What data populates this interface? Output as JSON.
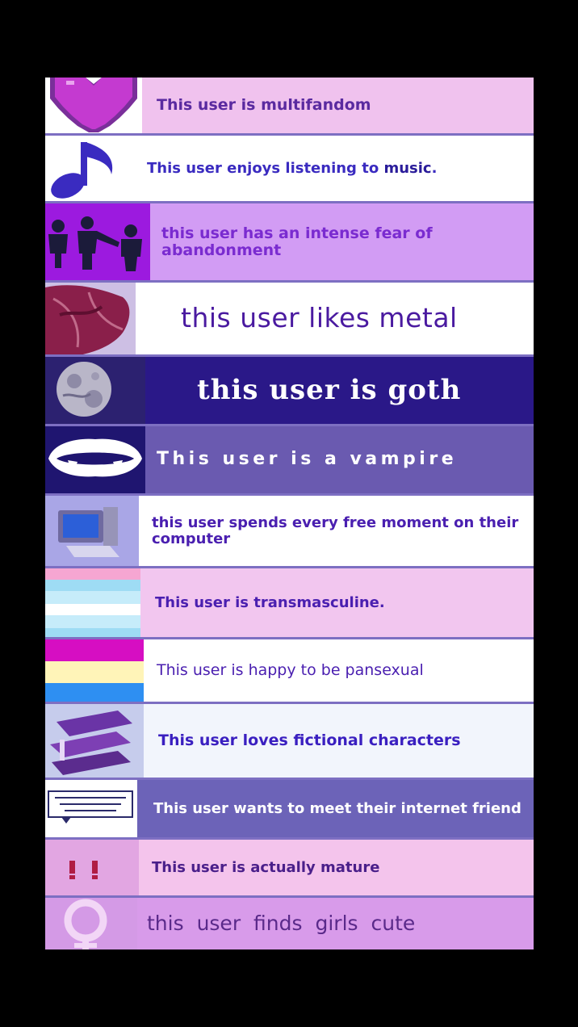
{
  "userboxes": [
    {
      "text": "This user is multifandom",
      "icon": "pixel-heart-icon"
    },
    {
      "text_before": "This user enjoys listening to ",
      "text_emphasis": "music",
      "text_after": ".",
      "icon": "music-note-icon"
    },
    {
      "text": "this user has an intense fear of abandonment",
      "icon": "people-pointing-icon"
    },
    {
      "text": "this user likes metal",
      "icon": "red-crumpled-texture-icon"
    },
    {
      "text": "this user is goth",
      "icon": "moon-icon"
    },
    {
      "text": "This user is a vampire",
      "icon": "fangs-icon"
    },
    {
      "text": "this user spends every free moment on their computer",
      "icon": "computer-icon"
    },
    {
      "text": "This user is transmasculine.",
      "icon": "transmasculine-flag-icon"
    },
    {
      "text": "This user is happy to be pansexual",
      "icon": "pansexual-flag-icon"
    },
    {
      "text": "This user loves fictional characters",
      "icon": "books-icon"
    },
    {
      "text": "This user wants to meet their internet friend",
      "icon": "note-card-icon"
    },
    {
      "text": "This user is actually mature",
      "icon": "double-exclamation-icon"
    },
    {
      "text": "this user finds girls cute",
      "icon": "venus-symbol-icon"
    }
  ],
  "colors": {
    "background": "#000000",
    "divider": "#7d6fc2",
    "pink_panel": "#f0c2ee",
    "light_violet": "#d29cf4",
    "goth_navy": "#2a1888",
    "vampire_violet": "#6a5ab0",
    "text_purple": "#5a2aa0"
  }
}
